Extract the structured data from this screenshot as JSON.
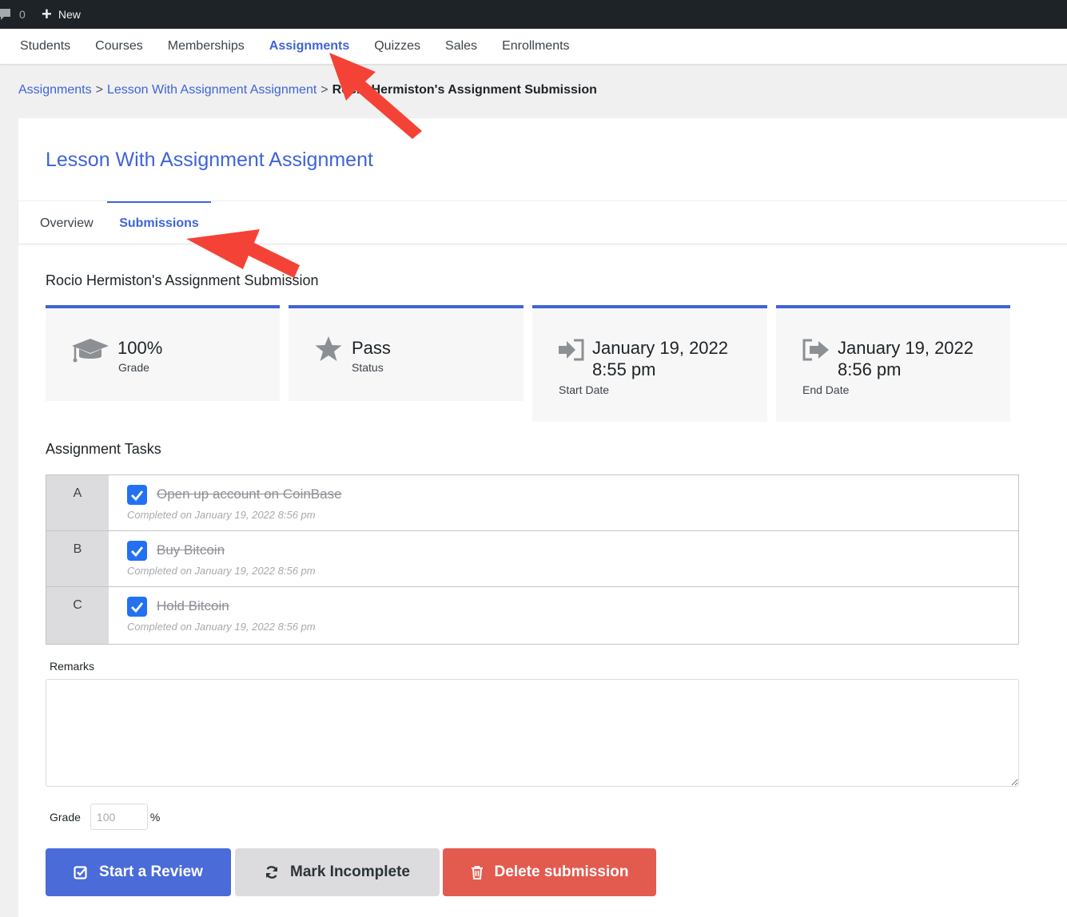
{
  "admin_bar": {
    "comment_count": "0",
    "new_label": "New"
  },
  "top_nav": {
    "items": [
      {
        "label": "Students",
        "active": false
      },
      {
        "label": "Courses",
        "active": false
      },
      {
        "label": "Memberships",
        "active": false
      },
      {
        "label": "Assignments",
        "active": true
      },
      {
        "label": "Quizzes",
        "active": false
      },
      {
        "label": "Sales",
        "active": false
      },
      {
        "label": "Enrollments",
        "active": false
      }
    ]
  },
  "breadcrumb": {
    "items": [
      "Assignments",
      "Lesson With Assignment  Assignment"
    ],
    "separator": ">",
    "current": "Rocio Hermiston's Assignment Submission"
  },
  "assignment": {
    "title": "Lesson With Assignment  Assignment"
  },
  "tabs": {
    "overview": "Overview",
    "submissions": "Submissions",
    "active": "submissions"
  },
  "submission": {
    "title": "Rocio Hermiston's Assignment Submission",
    "stats": {
      "grade": {
        "value": "100%",
        "label": "Grade",
        "icon": "graduation-cap-icon"
      },
      "status": {
        "value": "Pass",
        "label": "Status",
        "icon": "star-icon"
      },
      "start_date": {
        "date": "January 19, 2022",
        "time": "8:55 pm",
        "label": "Start Date",
        "icon": "sign-in-icon"
      },
      "end_date": {
        "date": "January 19, 2022",
        "time": "8:56 pm",
        "label": "End Date",
        "icon": "sign-out-icon"
      }
    }
  },
  "tasks": {
    "title": "Assignment Tasks",
    "items": [
      {
        "letter": "A",
        "text": "Open up account on CoinBase",
        "completed": "Completed on January 19, 2022 8:56 pm",
        "checked": true
      },
      {
        "letter": "B",
        "text": "Buy Bitcoin",
        "completed": "Completed on January 19, 2022 8:56 pm",
        "checked": true
      },
      {
        "letter": "C",
        "text": "Hold Bitcoin",
        "completed": "Completed on January 19, 2022 8:56 pm",
        "checked": true
      }
    ]
  },
  "remarks": {
    "label": "Remarks",
    "value": ""
  },
  "grade": {
    "label": "Grade",
    "placeholder": "100",
    "unit": "%"
  },
  "buttons": {
    "start_review": "Start a Review",
    "mark_incomplete": "Mark Incomplete",
    "delete_submission": "Delete submission"
  },
  "colors": {
    "accent": "#3f64d7",
    "review_button": "#4a6bd8",
    "delete_button": "#e35a4f",
    "checkbox": "#2271f1",
    "annotation_arrow": "#f44336"
  }
}
